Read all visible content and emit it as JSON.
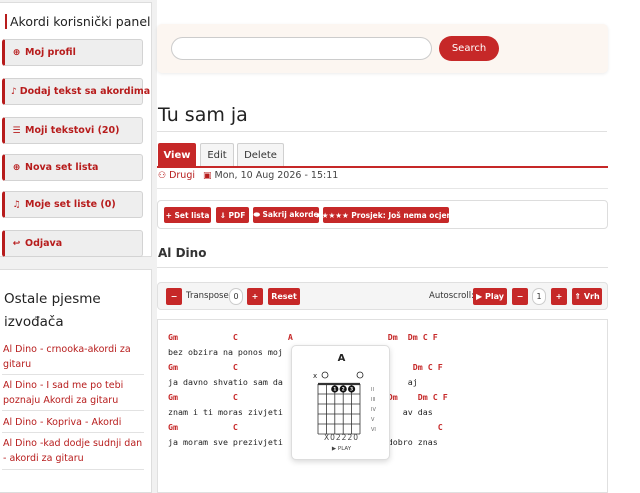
{
  "sidebar": {
    "title": "Akordi korisnički panel",
    "items": [
      {
        "icon": "⊕",
        "label": "Moj profil"
      },
      {
        "icon": "♪",
        "label": "Dodaj tekst sa akordima"
      },
      {
        "icon": "☰",
        "label": "Moji tekstovi (20)"
      },
      {
        "icon": "⊕",
        "label": "Nova set lista"
      },
      {
        "icon": "♫",
        "label": "Moje set liste (0)"
      },
      {
        "icon": "↩",
        "label": "Odjava"
      }
    ]
  },
  "other_songs": {
    "title": "Ostale pjesme izvođača",
    "links": [
      "Al Dino - crnooka-akordi za gitaru",
      "Al Dino - I sad me po tebi poznaju Akordi za gitaru",
      "Al Dino - Kopriva - Akordi",
      "Al Dino -kad dodje sudnji dan - akordi za gitaru"
    ]
  },
  "search": {
    "placeholder": "",
    "button_label": "Search"
  },
  "song": {
    "title": "Tu sam ja",
    "tabs": [
      "View",
      "Edit",
      "Delete"
    ],
    "author": "Drugi",
    "date": "Mon, 10 Aug 2026 - 15:11",
    "artist": "Al Dino"
  },
  "actions": {
    "set_list": "+ Set lista",
    "pdf": "⇓ PDF",
    "hide_chords": "⬬ Sakrij akorde",
    "rating": "★★★★★  Prosjek: Još nema ocjena"
  },
  "controls": {
    "minus": "−",
    "transpose_label": "Transpose:",
    "transpose_value": "0",
    "plus": "+",
    "reset": "Reset",
    "autoscroll_label": "Autoscroll:",
    "play": "▶ Play",
    "scroll_value": "1",
    "top": "⇑ Vrh"
  },
  "chord_lines": [
    {
      "type": "chord",
      "text": "Gm           C          A                   Dm  Dm C F"
    },
    {
      "type": "lyric",
      "text": "bez obzira na ponos moj"
    },
    {
      "type": "chord",
      "text": "Gm           C                                   Dm C F"
    },
    {
      "type": "lyric",
      "text": "ja davno shvatio sam da                         aj"
    },
    {
      "type": "chord",
      "text": "Gm           C                              Dm    Dm C F"
    },
    {
      "type": "lyric",
      "text": "znam i ti moras zivjeti                        av das"
    },
    {
      "type": "chord",
      "text": "Gm           C                                        C"
    },
    {
      "type": "lyric",
      "text": "ja moram sve prezivjeti                     dobro znas"
    }
  ],
  "chord_popup": {
    "name": "A",
    "fingering": "X02220",
    "play_label": "▶ PLAY",
    "fret_labels": [
      "II",
      "III",
      "IV",
      "V",
      "VI"
    ],
    "open_string_mark": "O",
    "muted_string_mark": "x"
  },
  "colors": {
    "accent": "#c62828",
    "panel": "#fcf6f1"
  }
}
